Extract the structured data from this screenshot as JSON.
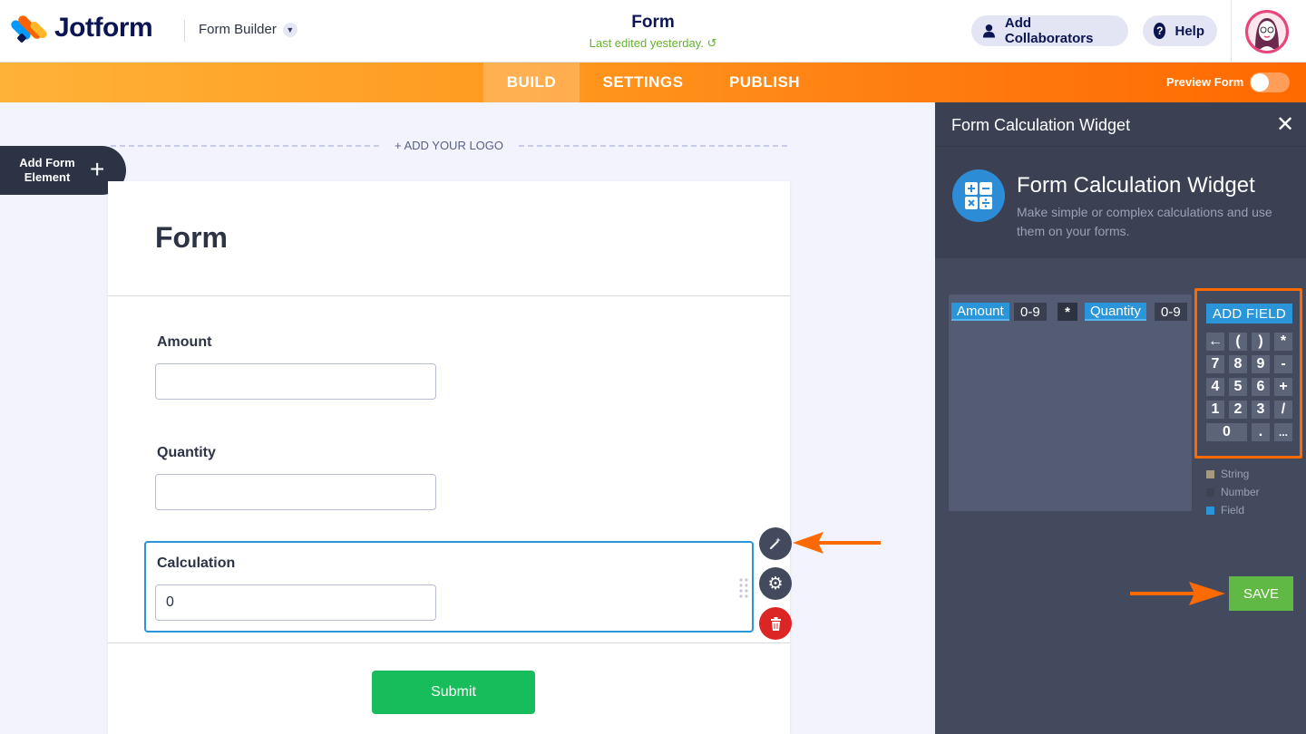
{
  "header": {
    "brand": "Jotform",
    "builder_label": "Form Builder",
    "form_title": "Form",
    "last_edited": "Last edited yesterday.",
    "collaborators_label": "Add Collaborators",
    "help_label": "Help"
  },
  "tabs": [
    {
      "label": "BUILD",
      "active": true
    },
    {
      "label": "SETTINGS",
      "active": false
    },
    {
      "label": "PUBLISH",
      "active": false
    }
  ],
  "preview_label": "Preview Form",
  "preview_on": false,
  "canvas": {
    "add_logo": "+ ADD YOUR LOGO",
    "add_element": "Add Form Element"
  },
  "form": {
    "heading": "Form",
    "fields": [
      {
        "label": "Amount",
        "value": ""
      },
      {
        "label": "Quantity",
        "value": ""
      },
      {
        "label": "Calculation",
        "value": "0"
      }
    ],
    "submit_label": "Submit"
  },
  "panel": {
    "header_title": "Form Calculation Widget",
    "widget_title": "Form Calculation Widget",
    "widget_desc": "Make simple or complex calculations and use them on your forms.",
    "formula": [
      {
        "type": "field",
        "text": "Amount"
      },
      {
        "type": "num",
        "text": "0-9"
      },
      {
        "type": "op",
        "text": "*"
      },
      {
        "type": "field",
        "text": "Quantity"
      },
      {
        "type": "num",
        "text": "0-9"
      }
    ],
    "add_field_label": "ADD FIELD",
    "keys": [
      [
        "←",
        "(",
        ")",
        "*"
      ],
      [
        "7",
        "8",
        "9",
        "-"
      ],
      [
        "4",
        "5",
        "6",
        "+"
      ],
      [
        "1",
        "2",
        "3",
        "/"
      ],
      [
        "0",
        ".",
        "..."
      ]
    ],
    "legend": [
      {
        "label": "String",
        "color": "#a79882"
      },
      {
        "label": "Number",
        "color": "#3d4352"
      },
      {
        "label": "Field",
        "color": "#2a95d8"
      }
    ],
    "save_label": "SAVE"
  },
  "colors": {
    "accent_orange": "#ff6a00",
    "field_blue": "#2a95d8",
    "save_green": "#5fb944",
    "submit_green": "#18bd5b"
  }
}
